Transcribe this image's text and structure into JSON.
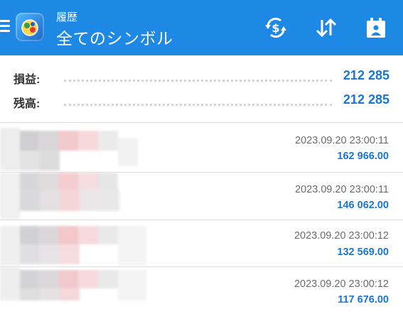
{
  "header": {
    "subtitle": "履歴",
    "title": "全てのシンボル",
    "actions": [
      {
        "icon": "currency-exchange-icon"
      },
      {
        "icon": "sort-icon"
      },
      {
        "icon": "calendar-icon"
      }
    ]
  },
  "summary": [
    {
      "label": "損益:",
      "value": "212 285"
    },
    {
      "label": "残高:",
      "value": "212 285"
    }
  ],
  "deals": [
    {
      "time": "2023.09.20 23:00:11",
      "amount": "162 966.00"
    },
    {
      "time": "2023.09.20 23:00:11",
      "amount": "146 062.00"
    },
    {
      "time": "2023.09.20 23:00:12",
      "amount": "132 569.00"
    },
    {
      "time": "2023.09.20 23:00:12",
      "amount": "117 676.00"
    }
  ],
  "colors": {
    "appbar": "#1e88e5",
    "value_blue": "#1976d2"
  }
}
